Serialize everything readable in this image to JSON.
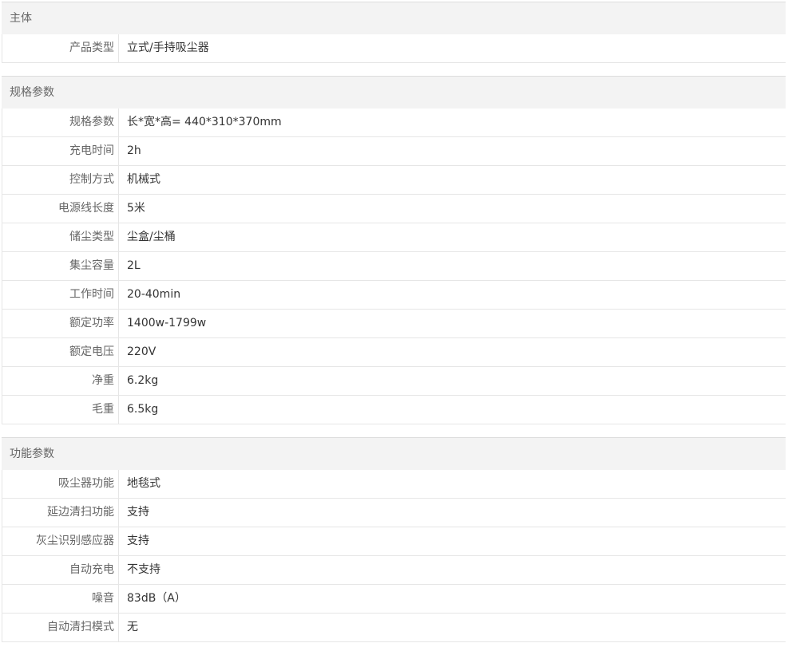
{
  "sections": [
    {
      "title": "主体",
      "rows": [
        {
          "label": "产品类型",
          "value": "立式/手持吸尘器"
        }
      ]
    },
    {
      "title": "规格参数",
      "rows": [
        {
          "label": "规格参数",
          "value": "长*宽*高= 440*310*370mm"
        },
        {
          "label": "充电时间",
          "value": "2h"
        },
        {
          "label": "控制方式",
          "value": "机械式"
        },
        {
          "label": "电源线长度",
          "value": "5米"
        },
        {
          "label": "储尘类型",
          "value": "尘盒/尘桶"
        },
        {
          "label": "集尘容量",
          "value": "2L"
        },
        {
          "label": "工作时间",
          "value": "20-40min"
        },
        {
          "label": "额定功率",
          "value": "1400w-1799w"
        },
        {
          "label": "额定电压",
          "value": "220V"
        },
        {
          "label": "净重",
          "value": "6.2kg"
        },
        {
          "label": "毛重",
          "value": "6.5kg"
        }
      ]
    },
    {
      "title": "功能参数",
      "rows": [
        {
          "label": "吸尘器功能",
          "value": "地毯式"
        },
        {
          "label": "延边清扫功能",
          "value": "支持"
        },
        {
          "label": "灰尘识别感应器",
          "value": "支持"
        },
        {
          "label": "自动充电",
          "value": "不支持"
        },
        {
          "label": "噪音",
          "value": "83dB（A）"
        },
        {
          "label": "自动清扫模式",
          "value": "无"
        }
      ]
    }
  ]
}
